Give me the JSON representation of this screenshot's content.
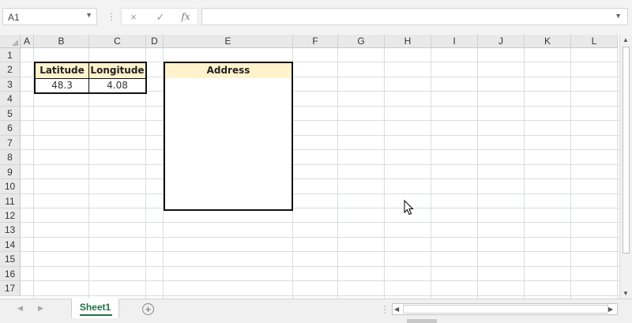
{
  "formula_bar": {
    "name_box": "A1",
    "divider": "⋮",
    "cancel_icon": "×",
    "enter_icon": "✓",
    "fx_label": "fx",
    "formula_value": ""
  },
  "columns": [
    "A",
    "B",
    "C",
    "D",
    "E",
    "F",
    "G",
    "H",
    "I",
    "J",
    "K",
    "L"
  ],
  "rows": [
    "1",
    "2",
    "3",
    "4",
    "5",
    "6",
    "7",
    "8",
    "9",
    "10",
    "11",
    "12",
    "13",
    "14",
    "15",
    "16",
    "17"
  ],
  "table": {
    "latitude_header": "Latitude",
    "longitude_header": "Longitude",
    "latitude_value": "48.3",
    "longitude_value": "4.08",
    "address_header": "Address"
  },
  "sheet_tabs": [
    {
      "label": "Sheet1",
      "active": true
    }
  ],
  "colors": {
    "header_fill": "#fff2cc",
    "active_tab": "#217346",
    "border": "#111111"
  },
  "icons": {
    "name_box_dropdown": "chevron-down-icon",
    "formula_expand": "chevron-down-icon",
    "add_sheet": "plus-circle-icon",
    "cursor": "mouse-pointer-icon"
  }
}
